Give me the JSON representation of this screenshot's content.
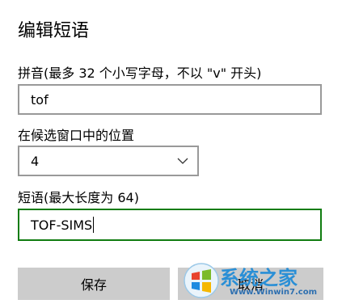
{
  "dialog": {
    "title": "编辑短语"
  },
  "pinyin": {
    "label": "拼音(最多 32 个小写字母，不以 \"v\" 开头)",
    "value": "tof"
  },
  "position": {
    "label": "在候选窗口中的位置",
    "selected": "4"
  },
  "phrase": {
    "label": "短语(最大长度为 64)",
    "value": "TOF-SIMS"
  },
  "buttons": {
    "save": "保存",
    "cancel": "取消"
  },
  "watermark": {
    "brand": "系统之家",
    "url": "Www.Winwin7.com"
  },
  "colors": {
    "focus_border": "#107c10",
    "field_border": "#999999",
    "button_bg": "#cccccc",
    "watermark_blue": "#2a8fd6"
  }
}
